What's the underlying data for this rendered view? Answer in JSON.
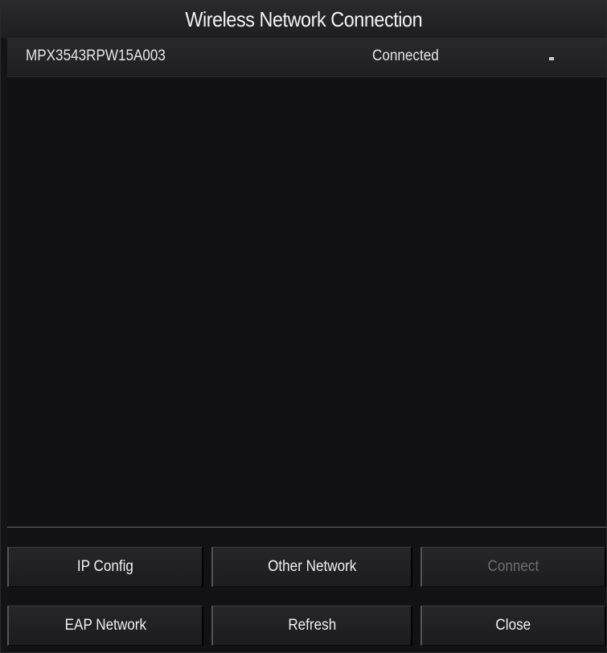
{
  "window": {
    "title": "Wireless Network Connection"
  },
  "networks": [
    {
      "ssid": "MPX3543RPW15A003",
      "status": "Connected",
      "signal_icon": "signal-indicator-icon"
    }
  ],
  "buttons": {
    "ip_config": "IP Config",
    "other_network": "Other Network",
    "connect": "Connect",
    "eap_network": "EAP Network",
    "refresh": "Refresh",
    "close": "Close"
  },
  "colors": {
    "background": "#141416",
    "text": "#f0f0f0",
    "disabled_text": "#6e6e70"
  }
}
